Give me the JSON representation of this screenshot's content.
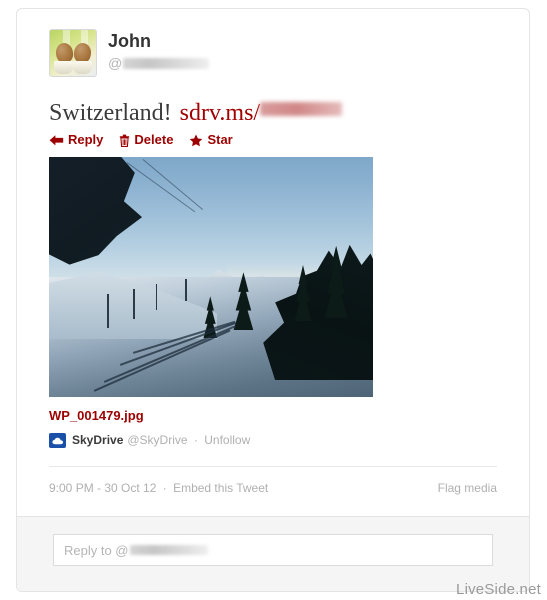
{
  "tweet": {
    "author": {
      "display_name": "John",
      "handle_prefix": "@",
      "handle_redacted": true,
      "avatar_icon": "chicks-avatar"
    },
    "text_plain": "Switzerland!",
    "text_link": "sdrv.ms/",
    "actions": [
      {
        "id": "reply",
        "label": "Reply",
        "icon": "reply-arrow-icon"
      },
      {
        "id": "delete",
        "label": "Delete",
        "icon": "trash-icon"
      },
      {
        "id": "star",
        "label": "Star",
        "icon": "star-icon"
      }
    ],
    "media": {
      "filename": "WP_001479.jpg",
      "alt": "Snow-covered railway tracks curving through a Swiss alpine forest at dusk"
    },
    "source": {
      "icon": "skydrive-cloud-icon",
      "name": "SkyDrive",
      "handle": "@SkyDrive",
      "separator": "·",
      "follow_action": "Unfollow"
    },
    "meta": {
      "timestamp": "9:00 PM - 30 Oct 12",
      "separator": "·",
      "embed_label": "Embed this Tweet",
      "flag_label": "Flag media"
    }
  },
  "reply": {
    "placeholder_prefix": "Reply to @",
    "handle_redacted": true
  },
  "watermark": "LiveSide.net",
  "colors": {
    "link_red": "#a10000",
    "action_red": "#9c0000",
    "text_dark": "#3b3b3b",
    "muted_gray": "#b0b0b0",
    "skydrive_blue": "#1b50a8",
    "card_border": "#e4e4e4",
    "footer_bg": "#f5f5f5"
  }
}
